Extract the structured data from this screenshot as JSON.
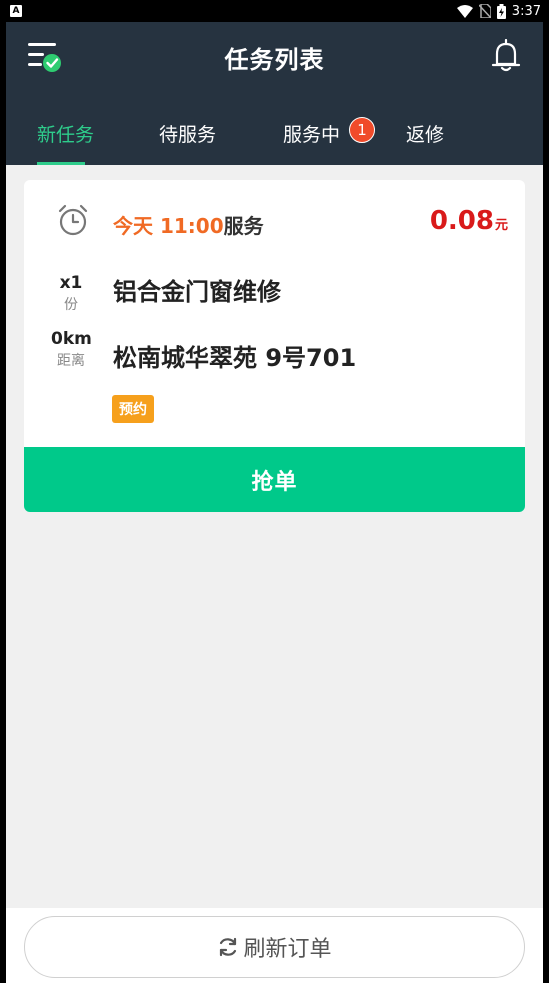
{
  "status_bar": {
    "time": "3:37",
    "notification_icon": "A"
  },
  "header": {
    "title": "任务列表",
    "menu_icon": "menu-check-icon",
    "bell_icon": "bell-icon"
  },
  "tabs": [
    {
      "label": "新任务",
      "active": true
    },
    {
      "label": "待服务",
      "active": false
    },
    {
      "label": "服务中",
      "active": false,
      "badge": "1"
    },
    {
      "label": "返修",
      "active": false
    }
  ],
  "task": {
    "time_highlight": "今天 11:00",
    "time_suffix": "服务",
    "price": "0.08",
    "price_unit": "元",
    "quantity": "x1",
    "quantity_unit": "份",
    "distance": "0km",
    "distance_label": "距离",
    "service_name": "铝合金门窗维修",
    "address": "松南城华翠苑 9号701",
    "tag": "预约",
    "grab_label": "抢单"
  },
  "footer": {
    "refresh_label": "刷新订单"
  },
  "colors": {
    "header_bg": "#263340",
    "accent": "#00c98a",
    "price": "#d91a1a",
    "time": "#f06a24",
    "tag": "#f6a01c",
    "badge": "#f04b2a"
  }
}
